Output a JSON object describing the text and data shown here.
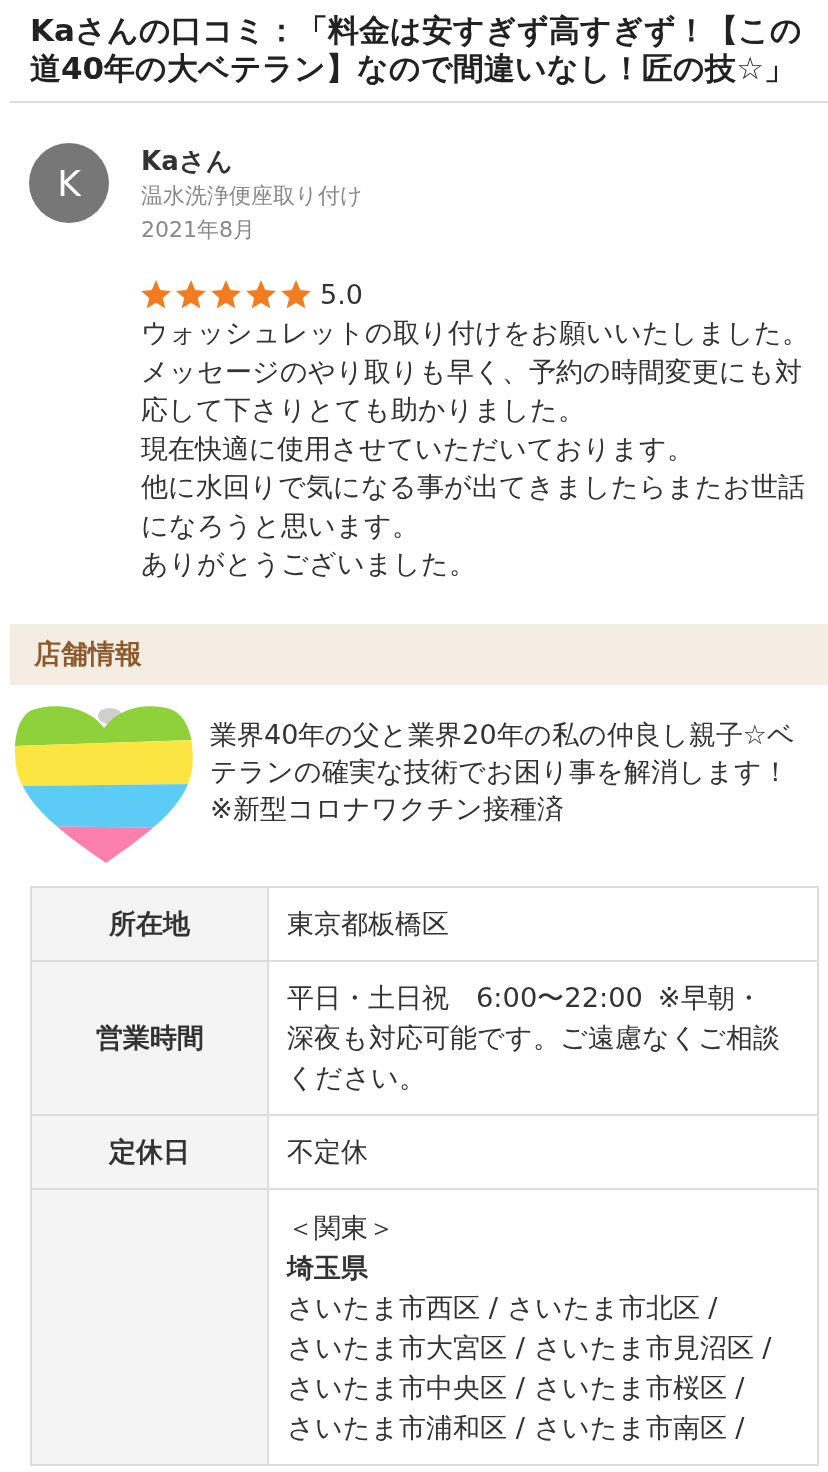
{
  "page_title": "Kaさんの口コミ：「料金は安すぎず高すぎず！【この道40年の大ベテラン】なので間違いなし！匠の技☆」",
  "review": {
    "avatar_initial": "K",
    "reviewer": "Kaさん",
    "service": "温水洗浄便座取り付け",
    "date": "2021年8月",
    "stars": 5,
    "rating": "5.0",
    "paragraphs": [
      "ウォッシュレットの取り付けをお願いいたしました。",
      "メッセージのやり取りも早く、予約の時間変更にも対応して下さりとても助かりました。",
      "現在快適に使用させていただいております。",
      "他に水回りで気になる事が出てきましたらまたお世話になろうと思います。",
      "ありがとうございました。"
    ]
  },
  "shop_info": {
    "heading": "店舗情報",
    "intro": [
      "業界40年の父と業界20年の私の仲良し親子☆ベテランの確実な技術でお困り事を解消します！",
      "※新型コロナワクチン接種済"
    ],
    "table": {
      "rows": [
        {
          "kind": "text",
          "label": "所在地",
          "value": "東京都板橋区"
        },
        {
          "kind": "text",
          "label": "営業時間",
          "value": "平日・土日祝　6:00〜22:00 ※早朝・深夜も対応可能です。ご遠慮なくご相談ください。"
        },
        {
          "kind": "text",
          "label": "定休日",
          "value": "不定休"
        },
        {
          "kind": "areas",
          "region": "＜関東＞",
          "prefecture": "埼玉県",
          "separator": "/",
          "areas": [
            "さいたま市西区",
            "さいたま市北区",
            "さいたま市大宮区",
            "さいたま市見沼区",
            "さいたま市中央区",
            "さいたま市桜区",
            "さいたま市浦和区",
            "さいたま市南区"
          ]
        }
      ]
    }
  }
}
